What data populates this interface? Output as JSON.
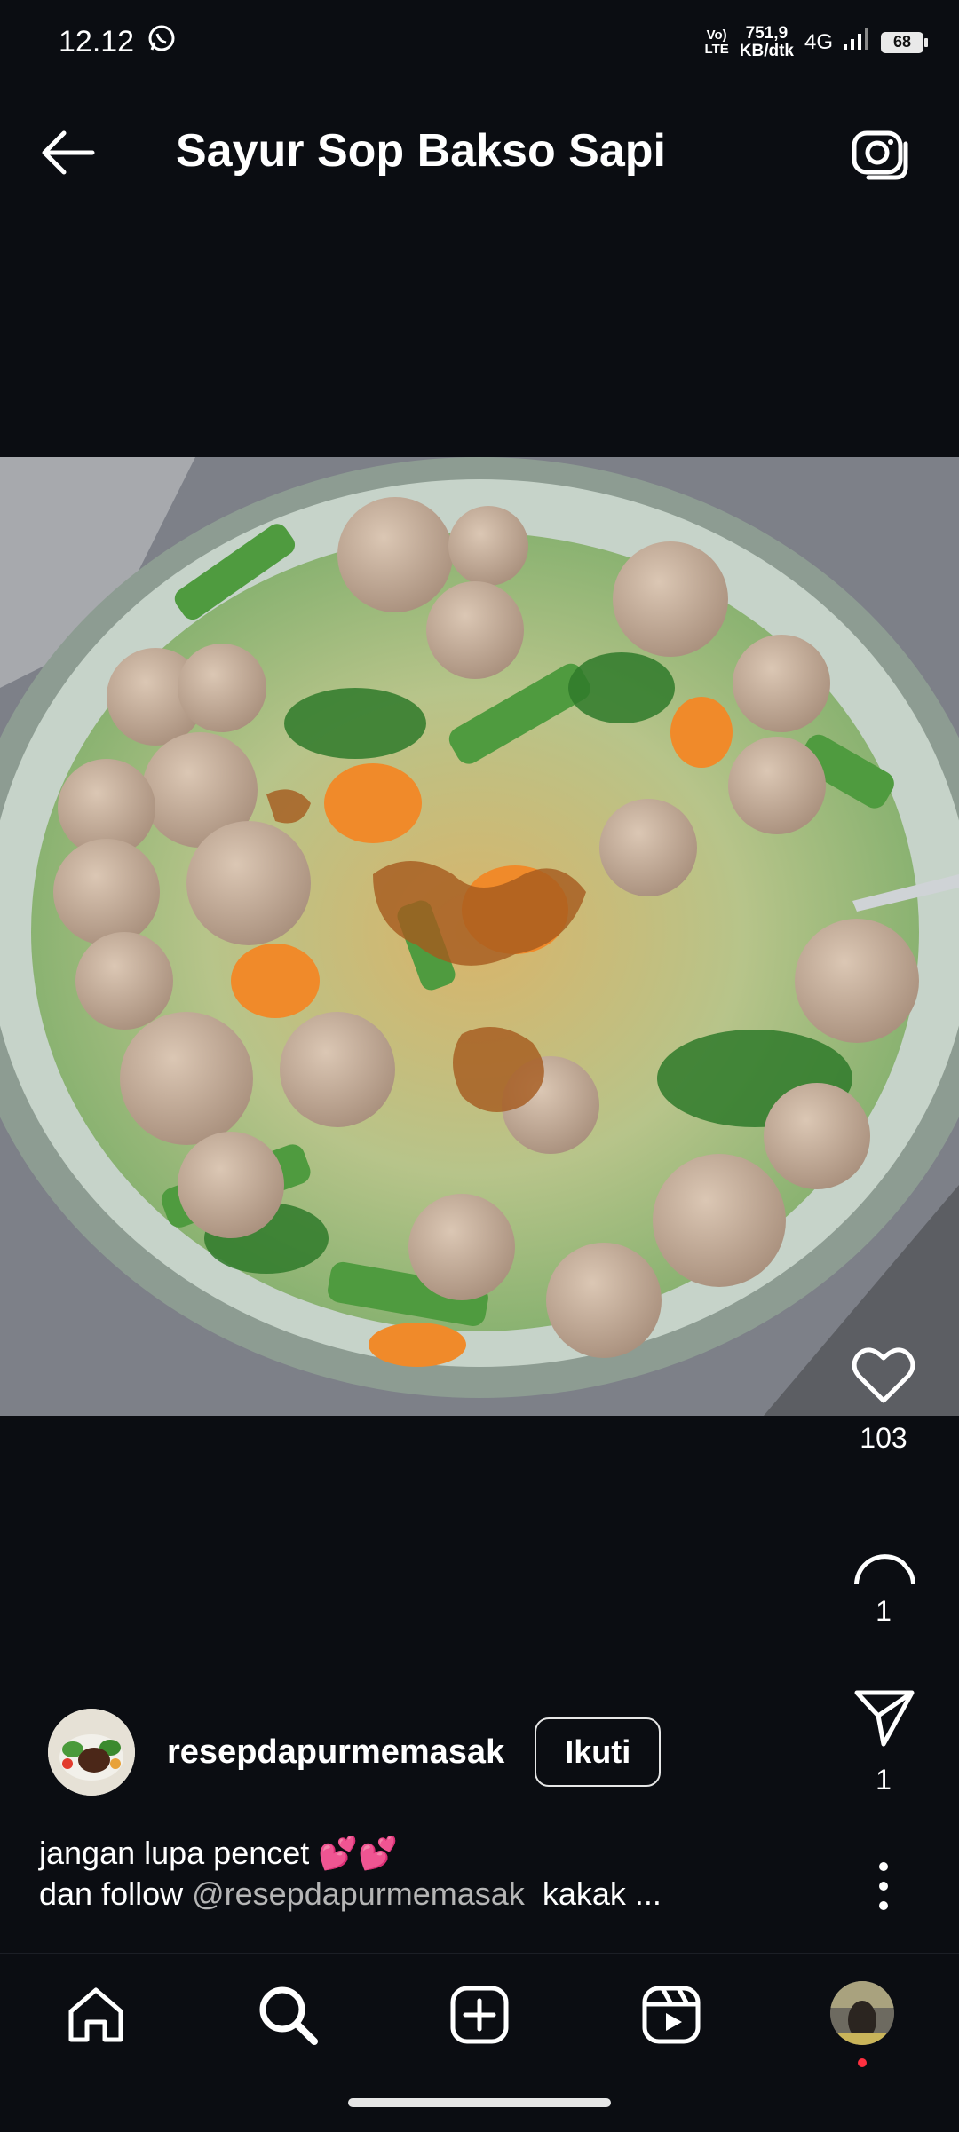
{
  "status_bar": {
    "time": "12.12",
    "volte_top": "Vo)",
    "volte_bottom": "LTE",
    "speed_value": "751,9",
    "speed_unit": "KB/dtk",
    "network": "4G",
    "battery": "68"
  },
  "header": {
    "title": "Sayur Sop Bakso Sapi",
    "back_icon": "arrow-left-icon",
    "camera_icon": "camera-icon"
  },
  "post": {
    "photo": "meatball-vegetable-soup-photo",
    "likes": "103",
    "comments": "1",
    "shares": "1"
  },
  "author": {
    "username": "resepdapurmemasak",
    "follow_label": "Ikuti"
  },
  "caption": {
    "line1": "jangan lupa pencet 💕💕",
    "line2_prefix": "dan follow ",
    "mention": "@resepdapurmemasak",
    "line2_suffix": "  kakak ..."
  },
  "bottom_nav": [
    "home-icon",
    "search-icon",
    "create-icon",
    "reels-icon",
    "profile-avatar"
  ],
  "colors": {
    "background": "#0b0d12",
    "notification_dot": "#ff3040"
  }
}
